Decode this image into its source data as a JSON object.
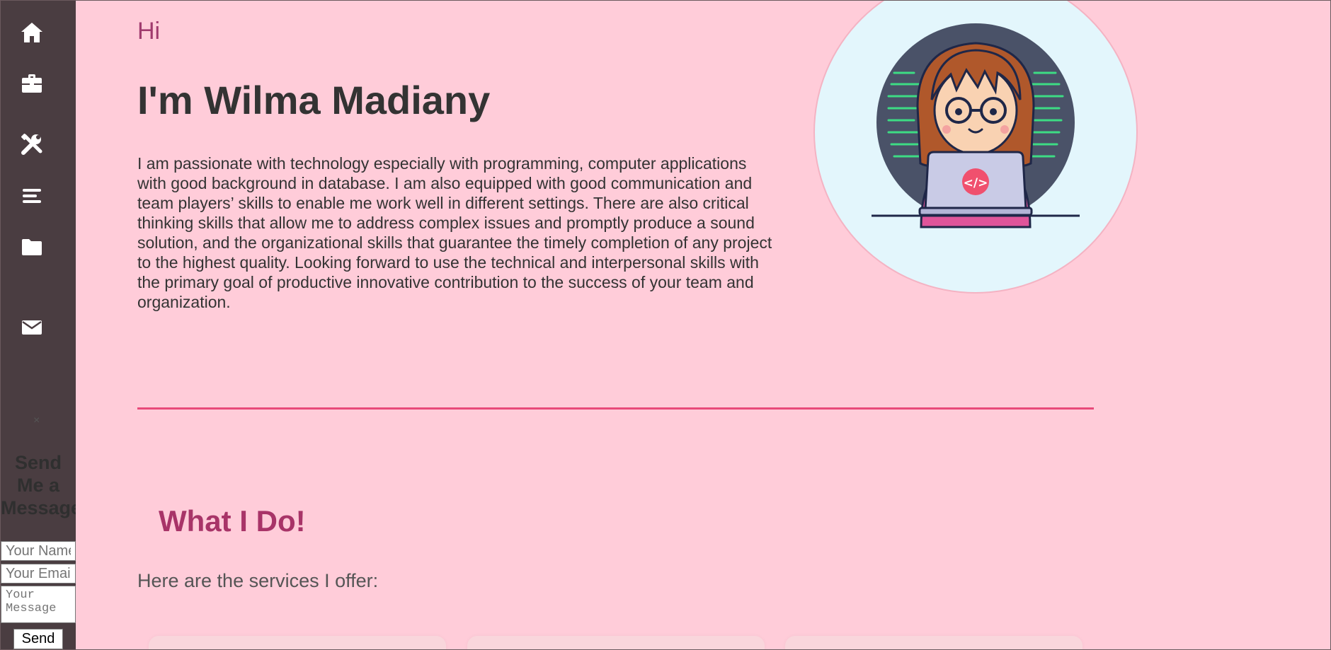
{
  "sidebar": {
    "nav": [
      {
        "icon": "home-icon"
      },
      {
        "icon": "briefcase-icon"
      },
      {
        "icon": "tools-icon"
      },
      {
        "icon": "menu-lines-icon"
      },
      {
        "icon": "folder-icon"
      },
      {
        "icon": "envelope-icon"
      }
    ],
    "message_form": {
      "close_label": "×",
      "title": "Send\nMe a\nMessage",
      "name_placeholder": "Your Name",
      "email_placeholder": "Your Email",
      "message_placeholder": "Your Message",
      "send_label": "Send"
    }
  },
  "hero": {
    "greeting": "Hi",
    "name": "I'm Wilma Madiany",
    "bio": "I am passionate with technology especially with programming, computer applications with good background in database. I am also equipped with good communication and team players’ skills to enable me work well in different settings. There are also critical thinking skills that allow me to address complex issues and promptly produce a sound solution, and the organizational skills that guarantee the timely completion of any project to the highest quality. Looking forward to use the technical and interpersonal skills with the primary goal of productive innovative contribution to the success of your team and organization.",
    "avatar_code_label": "</>"
  },
  "services": {
    "title": "What I Do!",
    "subtitle": "Here are the services I offer:"
  },
  "colors": {
    "background": "#ffccd9",
    "sidebar": "#4a3d41",
    "accent": "#e84a7a",
    "heading_accent": "#a83468"
  }
}
